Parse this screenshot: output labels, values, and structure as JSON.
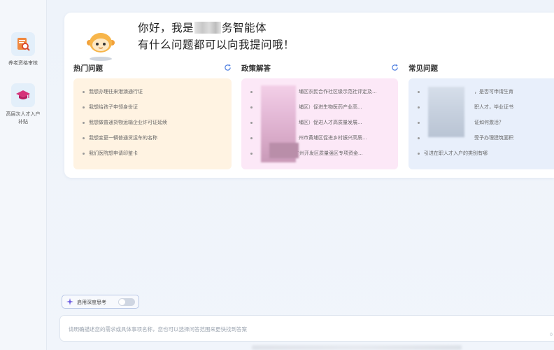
{
  "sidebar": {
    "items": [
      {
        "label": "养老资格审核",
        "icon": "document-search-icon",
        "color": "#e9692c"
      },
      {
        "label": "高层次人才入户补贴",
        "icon": "graduation-cap-icon",
        "color": "#d6337a"
      }
    ]
  },
  "welcome": {
    "greeting_part1": "你好，我是",
    "greeting_part2": "务智能体",
    "greeting_line2": "有什么问题都可以向我提问哦！"
  },
  "columns": [
    {
      "title": "热门问题",
      "bg": "#fff3e2",
      "items": [
        "我想办理往来港澳通行证",
        "我想给孩子申领身份证",
        "我想做普通货物运输企业许可证延续",
        "我想变更一辆普通货运车的名称",
        "我们医院想申请印鉴卡"
      ]
    },
    {
      "title": "政策解答",
      "bg": "#fce8f7",
      "items": [
        "埔区农民合作社区级示范社评定及...",
        "埔区）促进生物医药产业高...",
        "埔区）促进人才高质量发展...",
        "州市黄埔区促进乡村振兴高质...",
        "广州开发区质量强区专项资金..."
      ]
    },
    {
      "title": "常见问题",
      "bg": "#e8effb",
      "items": [
        "，是否可申请生育",
        "职人才，毕业证书",
        "证如何激活？",
        "受予办理建筑面积",
        "引进在职人才入户的类别有哪"
      ]
    }
  ],
  "deep_thinking": {
    "label": "启用深度思考",
    "enabled": false
  },
  "input": {
    "placeholder": "请明确描述您的需求或具体事项名称，您也可以选择问答范围来更快找到答案",
    "counter": "0"
  },
  "colors": {
    "accent": "#4f7fe0",
    "hot_bg": "#fff3e2",
    "policy_bg": "#fce8f7",
    "faq_bg": "#e8effb"
  }
}
